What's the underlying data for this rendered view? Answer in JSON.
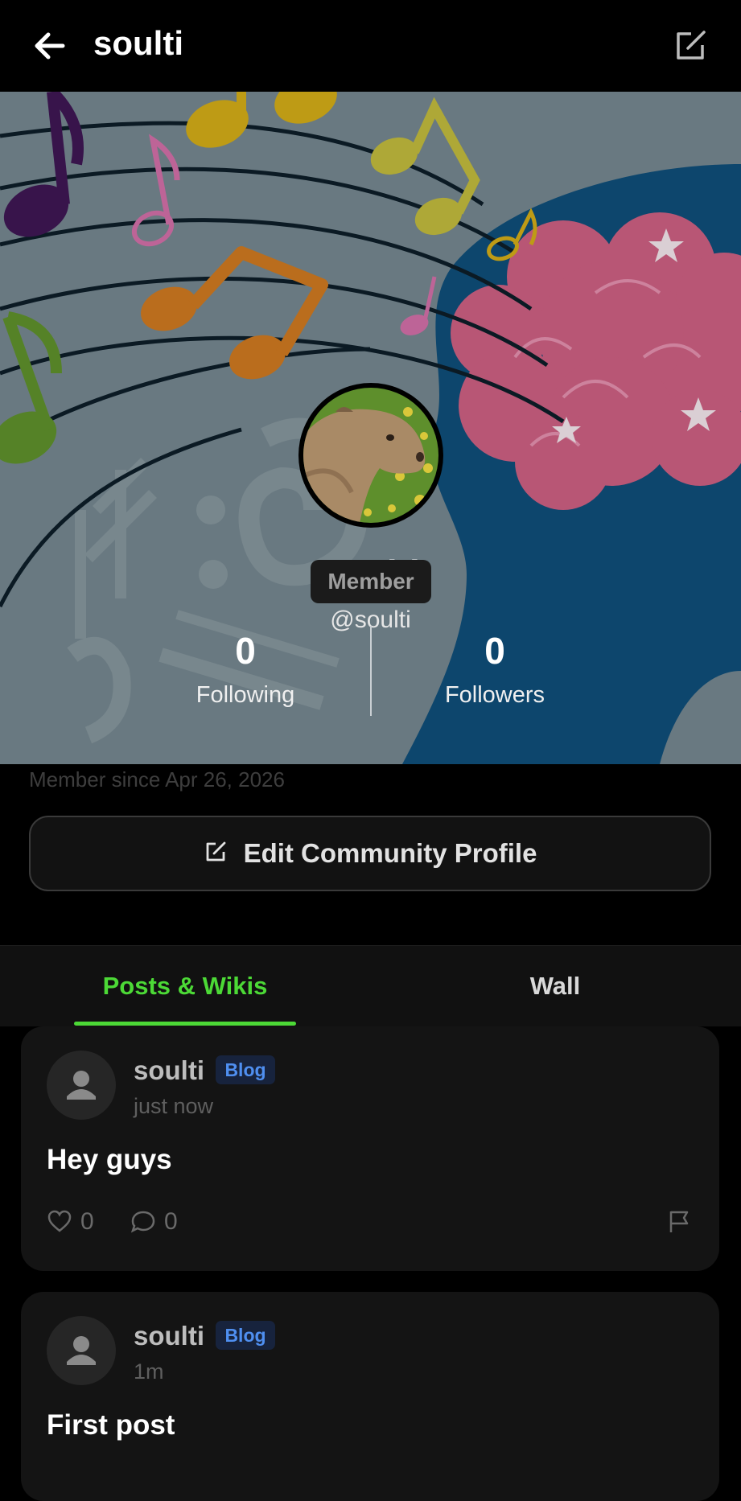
{
  "header": {
    "title": "soulti"
  },
  "profile": {
    "name": "soulti",
    "handle": "@soulti",
    "role": "Member",
    "following_count": "0",
    "following_label": "Following",
    "followers_count": "0",
    "followers_label": "Followers",
    "member_since": "Member since Apr 26, 2026",
    "edit_button": "Edit Community Profile"
  },
  "tabs": [
    {
      "label": "Posts & Wikis",
      "active": true
    },
    {
      "label": "Wall",
      "active": false
    }
  ],
  "posts": [
    {
      "author": "soulti",
      "badge": "Blog",
      "time": "just now",
      "title": "Hey guys",
      "likes": "0",
      "comments": "0"
    },
    {
      "author": "soulti",
      "badge": "Blog",
      "time": "1m",
      "title": "First post"
    }
  ],
  "colors": {
    "accent": "#4cd936",
    "badge": "#4f8ff0",
    "banner_blue": "#0e4a73",
    "brain_pink": "#c25b7c"
  }
}
